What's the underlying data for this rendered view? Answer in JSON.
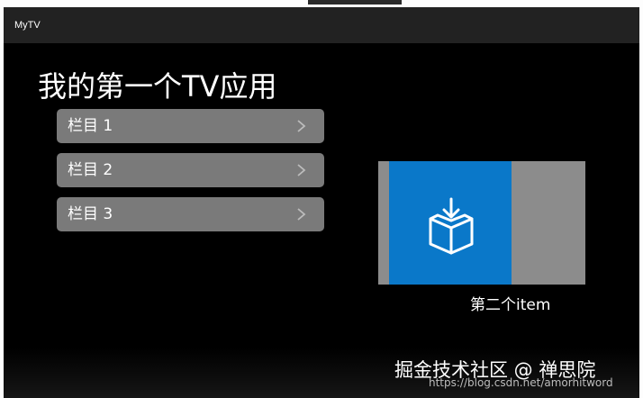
{
  "app": {
    "title": "MyTV"
  },
  "screen": {
    "title": "我的第一个TV应用"
  },
  "menu": {
    "items": [
      {
        "label": "栏目 1"
      },
      {
        "label": "栏目 2"
      },
      {
        "label": "栏目 3"
      }
    ]
  },
  "card": {
    "caption": "第二个item",
    "icon": "box-download-icon"
  },
  "overlay": {
    "watermark": "掘金技术社区 @ 禅思院",
    "url": "https://blog.csdn.net/amorhitword"
  },
  "colors": {
    "background": "#000000",
    "menu_item": "#7a7a7a",
    "card_bg": "#8c8c8c",
    "tile_blue": "#0a78c9"
  }
}
